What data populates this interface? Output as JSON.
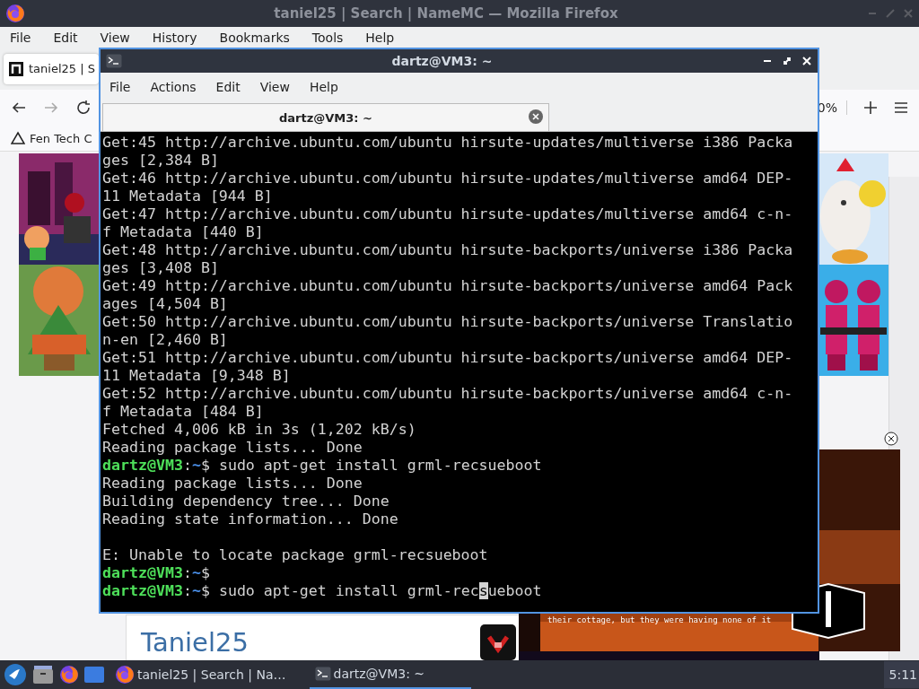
{
  "browser": {
    "title": "taniel25 | Search | NameMC — Mozilla Firefox",
    "menu": [
      "File",
      "Edit",
      "View",
      "History",
      "Bookmarks",
      "Tools",
      "Help"
    ],
    "tab": {
      "label": "taniel25 | S",
      "selected": true
    },
    "zoom_level": "0%",
    "bookmark": "Fen Tech C",
    "page": {
      "profile_name": "Taniel25",
      "video_caption": "their cottage, but they were having none of it"
    }
  },
  "terminal": {
    "title": "dartz@VM3: ~",
    "menu": [
      "File",
      "Actions",
      "Edit",
      "View",
      "Help"
    ],
    "tab": {
      "label": "dartz@VM3: ~",
      "selected": true
    },
    "lines": [
      {
        "kind": "output",
        "text": "Get:45 http://archive.ubuntu.com/ubuntu hirsute-updates/multiverse i386 Packa"
      },
      {
        "kind": "output",
        "text": "ges [2,384 B]"
      },
      {
        "kind": "output",
        "text": "Get:46 http://archive.ubuntu.com/ubuntu hirsute-updates/multiverse amd64 DEP-"
      },
      {
        "kind": "output",
        "text": "11 Metadata [944 B]"
      },
      {
        "kind": "output",
        "text": "Get:47 http://archive.ubuntu.com/ubuntu hirsute-updates/multiverse amd64 c-n-"
      },
      {
        "kind": "output",
        "text": "f Metadata [440 B]"
      },
      {
        "kind": "output",
        "text": "Get:48 http://archive.ubuntu.com/ubuntu hirsute-backports/universe i386 Packa"
      },
      {
        "kind": "output",
        "text": "ges [3,408 B]"
      },
      {
        "kind": "output",
        "text": "Get:49 http://archive.ubuntu.com/ubuntu hirsute-backports/universe amd64 Pack"
      },
      {
        "kind": "output",
        "text": "ages [4,504 B]"
      },
      {
        "kind": "output",
        "text": "Get:50 http://archive.ubuntu.com/ubuntu hirsute-backports/universe Translatio"
      },
      {
        "kind": "output",
        "text": "n-en [2,460 B]"
      },
      {
        "kind": "output",
        "text": "Get:51 http://archive.ubuntu.com/ubuntu hirsute-backports/universe amd64 DEP-"
      },
      {
        "kind": "output",
        "text": "11 Metadata [9,348 B]"
      },
      {
        "kind": "output",
        "text": "Get:52 http://archive.ubuntu.com/ubuntu hirsute-backports/universe amd64 c-n-"
      },
      {
        "kind": "output",
        "text": "f Metadata [484 B]"
      },
      {
        "kind": "output",
        "text": "Fetched 4,006 kB in 3s (1,202 kB/s)"
      },
      {
        "kind": "output",
        "text": "Reading package lists... Done"
      },
      {
        "kind": "prompt",
        "user_host": "dartz@VM3",
        "separator": ":",
        "path": "~",
        "symbol": "$",
        "command": " sudo apt-get install grml-recsueboot"
      },
      {
        "kind": "output",
        "text": "Reading package lists... Done"
      },
      {
        "kind": "output",
        "text": "Building dependency tree... Done"
      },
      {
        "kind": "output",
        "text": "Reading state information... Done"
      },
      {
        "kind": "blank"
      },
      {
        "kind": "output",
        "text": "E: Unable to locate package grml-recsueboot"
      },
      {
        "kind": "prompt",
        "user_host": "dartz@VM3",
        "separator": ":",
        "path": "~",
        "symbol": "$"
      },
      {
        "kind": "prompt",
        "user_host": "dartz@VM3",
        "separator": ":",
        "path": "~",
        "symbol": "$",
        "command": " sudo apt-get install grml-rec",
        "cursor_char": "s",
        "command_rest": "ueboot"
      }
    ]
  },
  "taskbar": {
    "buttons": [
      {
        "label": "taniel25 | Search | Na…",
        "kind": "browser",
        "selected": false
      },
      {
        "label": "dartz@VM3: ~",
        "kind": "terminal",
        "selected": true
      }
    ],
    "clock": "5:11"
  }
}
